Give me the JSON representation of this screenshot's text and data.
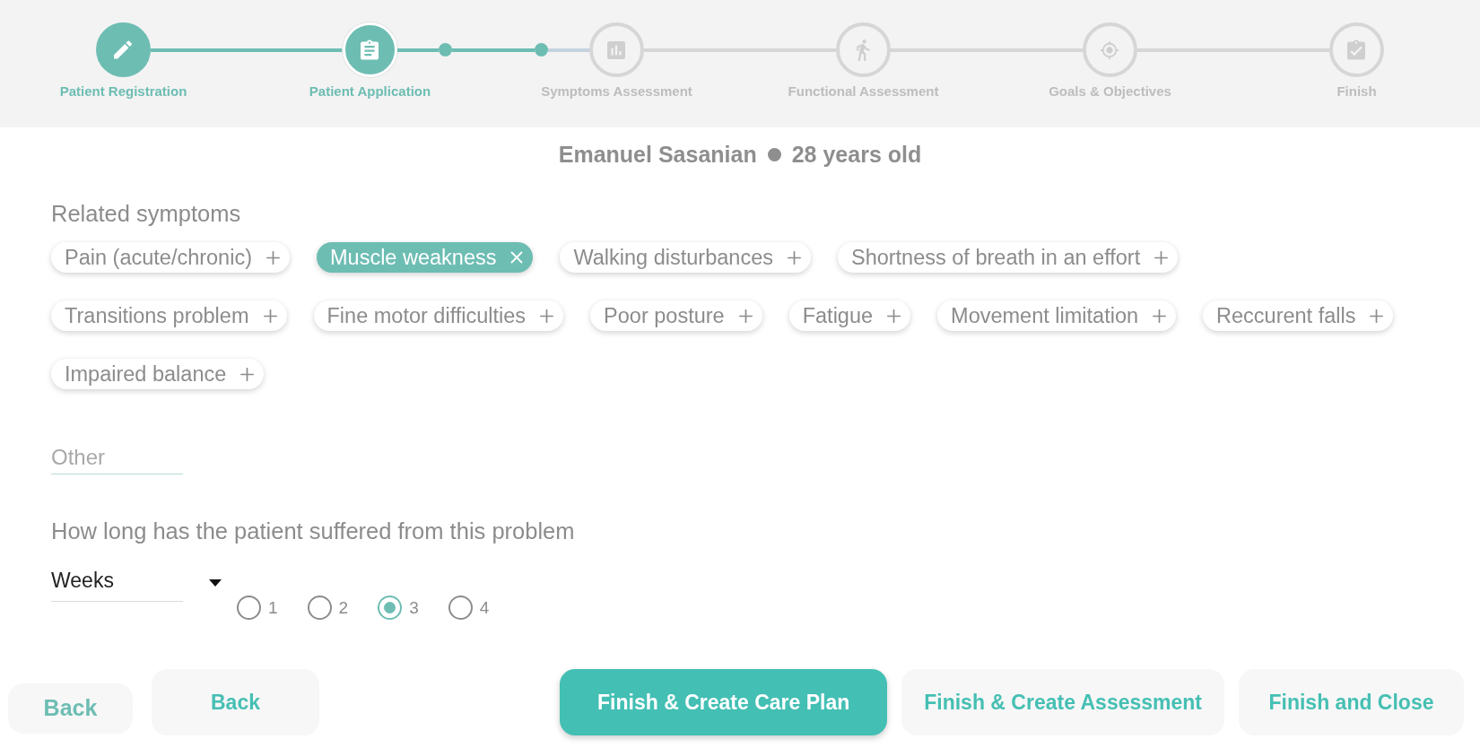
{
  "stepper": {
    "steps": [
      {
        "label": "Patient Registration",
        "completed": true,
        "active": false
      },
      {
        "label": "Patient Application",
        "completed": false,
        "active": true,
        "substeps": [
          {
            "reached": true
          },
          {
            "reached": true
          }
        ]
      },
      {
        "label": "Symptoms Assessment",
        "completed": false,
        "active": false
      },
      {
        "label": "Functional Assessment",
        "completed": false,
        "active": false
      },
      {
        "label": "Goals & Objectives",
        "completed": false,
        "active": false
      },
      {
        "label": "Finish",
        "completed": false,
        "active": false
      }
    ]
  },
  "patient": {
    "name": "Emanuel Sasanian",
    "age": "28 years old"
  },
  "symptoms": {
    "label": "Related symptoms",
    "chips": [
      {
        "label": "Pain (acute/chronic)",
        "selected": false
      },
      {
        "label": "Muscle weakness",
        "selected": true
      },
      {
        "label": "Walking disturbances",
        "selected": false
      },
      {
        "label": "Shortness of breath in an effort",
        "selected": false
      },
      {
        "label": "Transitions problem",
        "selected": false
      },
      {
        "label": "Fine motor difficulties",
        "selected": false
      },
      {
        "label": "Poor posture",
        "selected": false
      },
      {
        "label": "Fatigue",
        "selected": false
      },
      {
        "label": "Movement limitation",
        "selected": false
      },
      {
        "label": "Reccurent falls",
        "selected": false
      },
      {
        "label": "Impaired balance",
        "selected": false
      }
    ]
  },
  "other_field": {
    "placeholder": "Other"
  },
  "duration": {
    "question": "How long has the patient suffered from this problem",
    "unit_select": {
      "value": "Weeks"
    },
    "options": [
      {
        "label": "1",
        "selected": false
      },
      {
        "label": "2",
        "selected": false
      },
      {
        "label": "3",
        "selected": true
      },
      {
        "label": "4",
        "selected": false
      }
    ]
  },
  "nav_buttons": [
    {
      "label": "Back",
      "kind": "flat"
    },
    {
      "label": "Back",
      "kind": "soft"
    }
  ],
  "finish_buttons": [
    {
      "label": "Finish & Create Care Plan",
      "kind": "primary"
    },
    {
      "label": "Finish & Create Assessment",
      "kind": "soft"
    },
    {
      "label": "Finish and Close",
      "kind": "soft"
    }
  ]
}
